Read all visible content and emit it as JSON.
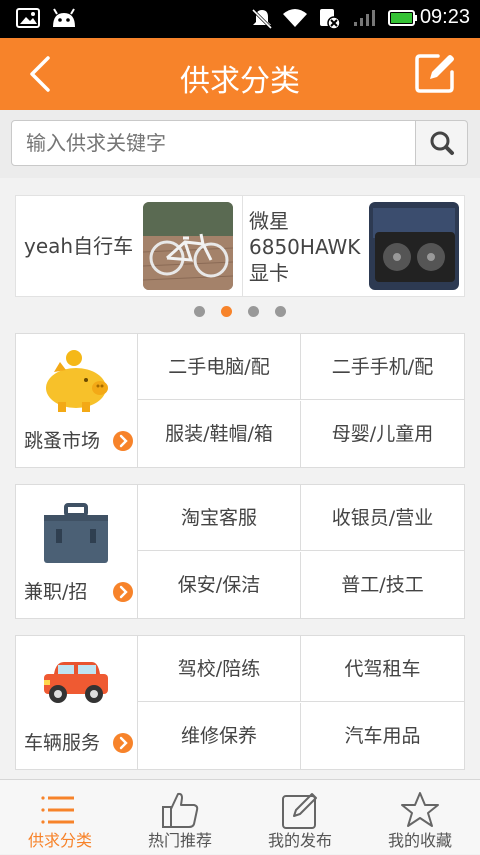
{
  "status_bar": {
    "time": "09:23",
    "battery_color": "#36c236"
  },
  "header": {
    "title": "供求分类",
    "back_icon": "chevron-left-icon",
    "edit_icon": "edit-icon"
  },
  "search": {
    "placeholder": "输入供求关键字",
    "button_icon": "search-icon"
  },
  "banner": {
    "items": [
      {
        "label": "yeah自行车"
      },
      {
        "label_lines": [
          "微星",
          "6850HAWK",
          "显卡"
        ]
      }
    ],
    "page_count": 4,
    "active_index": 1
  },
  "categories": [
    {
      "name": "跳蚤市场",
      "icon": "piggy-bank-icon",
      "subs": [
        "二手电脑/配",
        "二手手机/配",
        "服装/鞋帽/箱",
        "母婴/儿童用"
      ]
    },
    {
      "name": "兼职/招",
      "icon": "briefcase-icon",
      "subs": [
        "淘宝客服",
        "收银员/营业",
        "保安/保洁",
        "普工/技工"
      ]
    },
    {
      "name": "车辆服务",
      "icon": "car-icon",
      "subs": [
        "驾校/陪练",
        "代驾租车",
        "维修保养",
        "汽车用品"
      ]
    }
  ],
  "tabbar": {
    "items": [
      {
        "label": "供求分类",
        "icon": "list-icon",
        "active": true
      },
      {
        "label": "热门推荐",
        "icon": "thumbs-up-icon",
        "active": false
      },
      {
        "label": "我的发布",
        "icon": "edit-icon",
        "active": false
      },
      {
        "label": "我的收藏",
        "icon": "star-icon",
        "active": false
      }
    ]
  },
  "colors": {
    "accent": "#f7832a"
  }
}
